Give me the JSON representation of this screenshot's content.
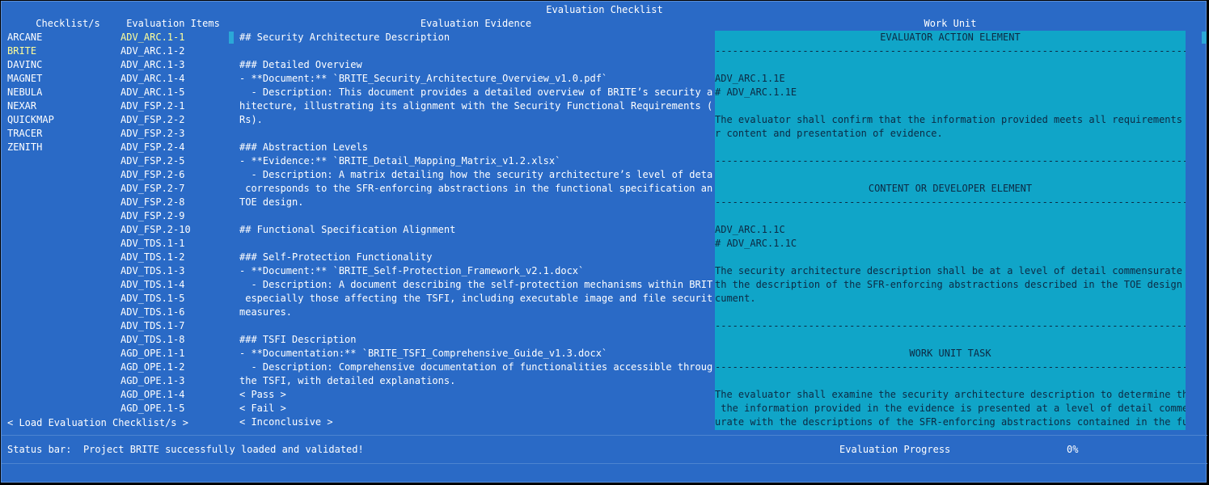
{
  "window": {
    "title": "Evaluation Checklist"
  },
  "headers": {
    "checklists": "Checklist/s",
    "items": "Evaluation Items",
    "evidence": "Evaluation Evidence",
    "work_unit": "Work Unit"
  },
  "checklists": [
    "ARCANE",
    "BRITE",
    "DAVINC",
    "MAGNET",
    "NEBULA",
    "NEXAR",
    "QUICKMAP",
    "TRACER",
    "ZENITH"
  ],
  "selected_checklist": "BRITE",
  "items": [
    "ADV_ARC.1-1",
    "ADV_ARC.1-2",
    "ADV_ARC.1-3",
    "ADV_ARC.1-4",
    "ADV_ARC.1-5",
    "ADV_FSP.2-1",
    "ADV_FSP.2-2",
    "ADV_FSP.2-3",
    "ADV_FSP.2-4",
    "ADV_FSP.2-5",
    "ADV_FSP.2-6",
    "ADV_FSP.2-7",
    "ADV_FSP.2-8",
    "ADV_FSP.2-9",
    "ADV_FSP.2-10",
    "ADV_TDS.1-1",
    "ADV_TDS.1-2",
    "ADV_TDS.1-3",
    "ADV_TDS.1-4",
    "ADV_TDS.1-5",
    "ADV_TDS.1-6",
    "ADV_TDS.1-7",
    "ADV_TDS.1-8",
    "AGD_OPE.1-1",
    "AGD_OPE.1-2",
    "AGD_OPE.1-3",
    "AGD_OPE.1-4",
    "AGD_OPE.1-5"
  ],
  "selected_item": "ADV_ARC.1-1",
  "evidence_lines": [
    "## Security Architecture Description",
    "",
    "### Detailed Overview",
    "- **Document:** `BRITE_Security_Architecture_Overview_v1.0.pdf`",
    "  - Description: This document provides a detailed overview of BRITE’s security arc",
    "hitecture, illustrating its alignment with the Security Functional Requirements (SF",
    "Rs).",
    "",
    "### Abstraction Levels",
    "- **Evidence:** `BRITE_Detail_Mapping_Matrix_v1.2.xlsx`",
    "  - Description: A matrix detailing how the security architecture’s level of detail",
    " corresponds to the SFR-enforcing abstractions in the functional specification and",
    "TOE design.",
    "",
    "## Functional Specification Alignment",
    "",
    "### Self-Protection Functionality",
    "- **Document:** `BRITE_Self-Protection_Framework_v2.1.docx`",
    "  - Description: A document describing the self-protection mechanisms within BRITE,",
    " especially those affecting the TSFI, including executable image and file security",
    "measures.",
    "",
    "### TSFI Description",
    "- **Documentation:** `BRITE_TSFI_Comprehensive_Guide_v1.3.docx`",
    "  - Description: Comprehensive documentation of functionalities accessible through",
    "the TSFI, with detailed explanations."
  ],
  "verdict_buttons": [
    "< Pass >",
    "< Fail >",
    "< Inconclusive >"
  ],
  "work_unit_lines": [
    {
      "text": "EVALUATOR ACTION ELEMENT",
      "center": true
    },
    {
      "text": "",
      "sep": true
    },
    {
      "text": ""
    },
    {
      "text": "ADV_ARC.1.1E"
    },
    {
      "text": "# ADV_ARC.1.1E"
    },
    {
      "text": ""
    },
    {
      "text": "The evaluator shall confirm that the information provided meets all requirements fo"
    },
    {
      "text": "r content and presentation of evidence."
    },
    {
      "text": ""
    },
    {
      "text": "",
      "sep": true
    },
    {
      "text": ""
    },
    {
      "text": "CONTENT OR DEVELOPER ELEMENT",
      "center": true
    },
    {
      "text": "",
      "sep": true
    },
    {
      "text": ""
    },
    {
      "text": "ADV_ARC.1.1C"
    },
    {
      "text": "# ADV_ARC.1.1C"
    },
    {
      "text": ""
    },
    {
      "text": "The security architecture description shall be at a level of detail commensurate wi"
    },
    {
      "text": "th the description of the SFR-enforcing abstractions described in the TOE design do"
    },
    {
      "text": "cument."
    },
    {
      "text": ""
    },
    {
      "text": "",
      "sep": true
    },
    {
      "text": ""
    },
    {
      "text": "WORK UNIT TASK",
      "center": true
    },
    {
      "text": "",
      "sep": true
    },
    {
      "text": ""
    },
    {
      "text": "The evaluator shall examine the security architecture description to determine that"
    },
    {
      "text": " the information provided in the evidence is presented at a level of detail commens"
    },
    {
      "text": "urate with the descriptions of the SFR-enforcing abstractions contained in the func"
    }
  ],
  "load_button": "< Load Evaluation Checklist/s >",
  "status": {
    "label": "Status bar:",
    "message": "Project BRITE successfully loaded and validated!",
    "progress_label": "Evaluation Progress",
    "progress_value": "0%"
  },
  "colors": {
    "background": "#2a6ac6",
    "work_unit_panel": "#10a5c8",
    "highlight": "#ffff99"
  }
}
